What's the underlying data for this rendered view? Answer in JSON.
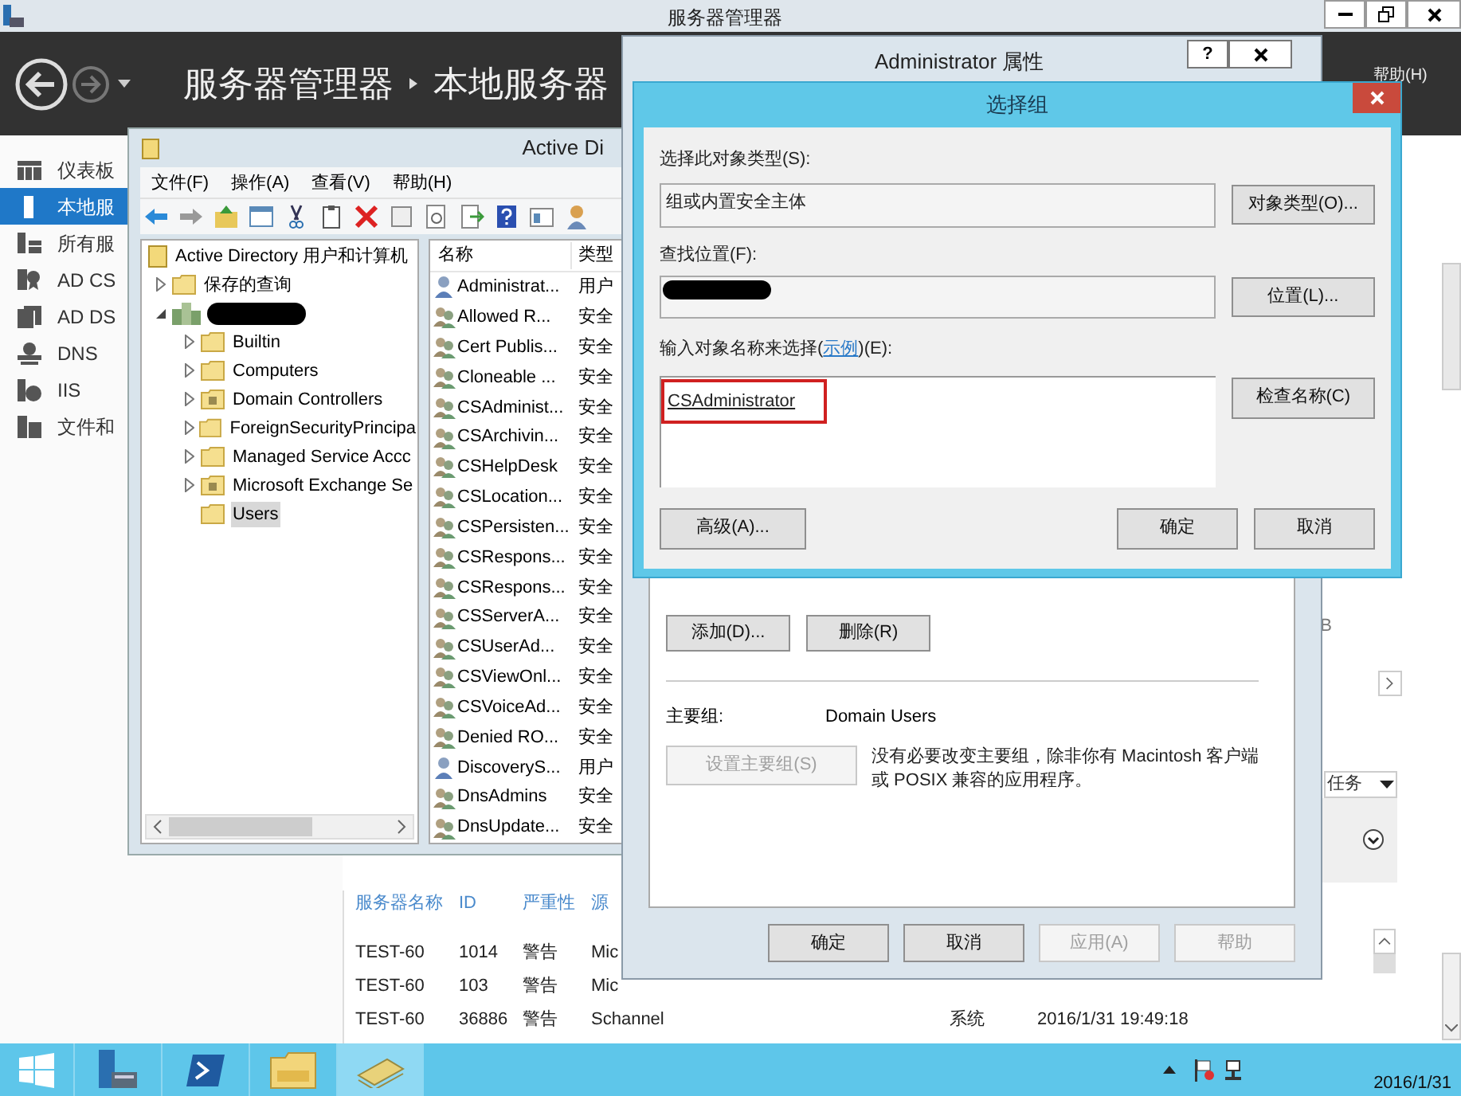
{
  "title_bar": {
    "title": "服务器管理器"
  },
  "header": {
    "breadcrumb": [
      "服务器管理器",
      "本地服务器"
    ],
    "menu": [
      "帮助(H)"
    ]
  },
  "nav": {
    "items": [
      {
        "label": "仪表板",
        "kind": "dashboard",
        "selected": false
      },
      {
        "label": "本地服",
        "kind": "server",
        "selected": true
      },
      {
        "label": "所有服",
        "kind": "servers",
        "selected": false
      },
      {
        "label": "AD CS",
        "kind": "adcs",
        "selected": false
      },
      {
        "label": "AD DS",
        "kind": "adds",
        "selected": false
      },
      {
        "label": "DNS",
        "kind": "dns",
        "selected": false
      },
      {
        "label": "IIS",
        "kind": "iis",
        "selected": false
      },
      {
        "label": "文件和",
        "kind": "files",
        "selected": false
      }
    ]
  },
  "side_panel": {
    "fragment": "B",
    "tasks_label": "任务"
  },
  "events": {
    "columns": [
      "服务器名称",
      "ID",
      "严重性",
      "源"
    ],
    "rows": [
      [
        "TEST-60",
        "1014",
        "警告",
        "Mic"
      ],
      [
        "TEST-60",
        "103",
        "警告",
        "Mic"
      ],
      [
        "TEST-60",
        "36886",
        "警告",
        "Schannel",
        "系统",
        "2016/1/31 19:49:18"
      ]
    ]
  },
  "aduc": {
    "title": "Active Di",
    "menu": [
      "文件(F)",
      "操作(A)",
      "查看(V)",
      "帮助(H)"
    ],
    "tree": {
      "label": "Active Directory 用户和计算机",
      "kind": "root",
      "selected": false,
      "children": [
        {
          "label": "保存的查询",
          "kind": "folder",
          "expanded": false,
          "selected": false
        },
        {
          "kind": "domain",
          "expanded": true,
          "selected": false,
          "children": [
            {
              "label": "Builtin",
              "kind": "folder",
              "expanded": false,
              "selected": false
            },
            {
              "label": "Computers",
              "kind": "folder",
              "expanded": false,
              "selected": false
            },
            {
              "label": "Domain Controllers",
              "kind": "ou",
              "expanded": false,
              "selected": false
            },
            {
              "label": "ForeignSecurityPrincipa",
              "kind": "folder",
              "expanded": false,
              "selected": false
            },
            {
              "label": "Managed Service Accc",
              "kind": "folder",
              "expanded": false,
              "selected": false
            },
            {
              "label": "Microsoft Exchange Se",
              "kind": "ou",
              "expanded": false,
              "selected": false
            },
            {
              "label": "Users",
              "kind": "folder",
              "selected": true
            }
          ]
        }
      ]
    },
    "list": {
      "columns": [
        "名称",
        "类型"
      ],
      "rows": [
        {
          "name": "Administrat...",
          "type": "用户",
          "kind": "user"
        },
        {
          "name": "Allowed R...",
          "type": "安全",
          "kind": "group"
        },
        {
          "name": "Cert Publis...",
          "type": "安全",
          "kind": "group"
        },
        {
          "name": "Cloneable ...",
          "type": "安全",
          "kind": "group"
        },
        {
          "name": "CSAdminist...",
          "type": "安全",
          "kind": "group"
        },
        {
          "name": "CSArchivin...",
          "type": "安全",
          "kind": "group"
        },
        {
          "name": "CSHelpDesk",
          "type": "安全",
          "kind": "group"
        },
        {
          "name": "CSLocation...",
          "type": "安全",
          "kind": "group"
        },
        {
          "name": "CSPersisten...",
          "type": "安全",
          "kind": "group"
        },
        {
          "name": "CSRespons...",
          "type": "安全",
          "kind": "group"
        },
        {
          "name": "CSRespons...",
          "type": "安全",
          "kind": "group"
        },
        {
          "name": "CSServerA...",
          "type": "安全",
          "kind": "group"
        },
        {
          "name": "CSUserAd...",
          "type": "安全",
          "kind": "group"
        },
        {
          "name": "CSViewOnl...",
          "type": "安全",
          "kind": "group"
        },
        {
          "name": "CSVoiceAd...",
          "type": "安全",
          "kind": "group"
        },
        {
          "name": "Denied RO...",
          "type": "安全",
          "kind": "group"
        },
        {
          "name": "DiscoveryS...",
          "type": "用户",
          "kind": "user"
        },
        {
          "name": "DnsAdmins",
          "type": "安全",
          "kind": "group"
        },
        {
          "name": "DnsUpdate...",
          "type": "安全",
          "kind": "group"
        }
      ]
    }
  },
  "properties": {
    "title": "Administrator 属性",
    "help_glyph": "?",
    "add_button": "添加(D)...",
    "remove_button": "删除(R)",
    "primary_group_label": "主要组:",
    "primary_group": "Domain Users",
    "set_primary_button": {
      "label": "设置主要组(S)",
      "disabled": true
    },
    "note": "没有必要改变主要组，除非你有 Macintosh 客户端或 POSIX 兼容的应用程序。",
    "buttons": [
      {
        "label": "确定",
        "disabled": false
      },
      {
        "label": "取消",
        "disabled": false
      },
      {
        "label": "应用(A)",
        "disabled": true
      },
      {
        "label": "帮助",
        "disabled": true
      }
    ]
  },
  "select_dialog": {
    "title": "选择组",
    "object_type_label": "选择此对象类型(S):",
    "object_type": "组或内置安全主体",
    "object_types_button": "对象类型(O)...",
    "location_label": "查找位置(F):",
    "location_button": "位置(L)...",
    "names_label_before": "输入对象名称来选择(",
    "names_link": "示例",
    "names_label_after": ")(E):",
    "names_value": "CSAdministrator",
    "check_button": "检查名称(C)",
    "advanced_button": "高级(A)...",
    "ok_button": "确定",
    "cancel_button": "取消"
  },
  "taskbar": {
    "apps": [
      {
        "kind": "server-manager",
        "selected": false
      },
      {
        "kind": "powershell",
        "selected": false
      },
      {
        "kind": "explorer",
        "selected": false
      },
      {
        "kind": "aduc",
        "selected": true
      }
    ],
    "date": "2016/1/31"
  }
}
